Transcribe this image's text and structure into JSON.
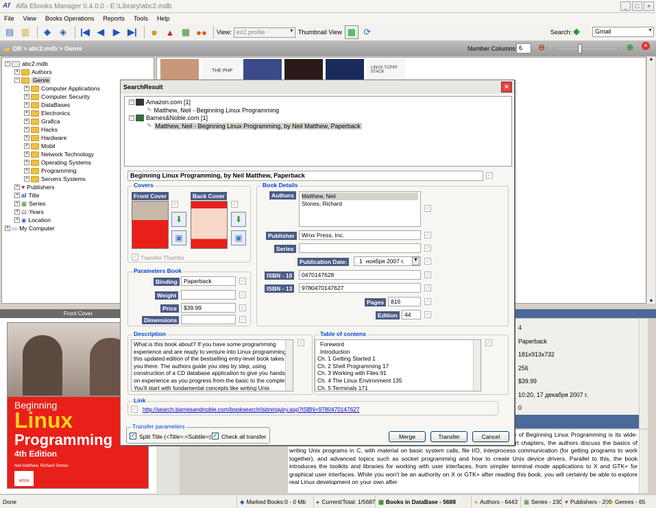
{
  "window": {
    "title": "Alfa Ebooks Manager 0.4.0.0 - E:\\Library\\abc2.mdb"
  },
  "menu": [
    "File",
    "View",
    "Books Operations",
    "Reports",
    "Tools",
    "Help"
  ],
  "toolbar": {
    "view_label": "View:",
    "view_value": "ex2.profile",
    "thumbnail_view": "Thumbnail View",
    "search_label": "Search:",
    "search_value": "Gmail"
  },
  "breadcrumb": {
    "text": "DB > abc2.mdb > Genre",
    "number_columns_label": "Number Columns:",
    "number_columns_value": "6"
  },
  "tree": {
    "root": "abc2.mdb",
    "authors": "Authors",
    "genre": "Genre",
    "genres": [
      "Computer Applications",
      "Computer Security",
      "DataBases",
      "Electronics",
      "Grafica",
      "Hacks",
      "Hardware",
      "Mobil",
      "Network Technology",
      "Operating Systems",
      "Programming",
      "Servers Systems"
    ],
    "others": [
      "Publishers",
      "Title",
      "Series",
      "Years",
      "Location"
    ],
    "my_computer": "My Computer"
  },
  "front_cover_header": "Front Cover",
  "cover_art": {
    "title_line1": "Beginning",
    "title_line2": "Linux",
    "title_line3": "Programming",
    "edition": "4th Edition",
    "authors": "Neil Matthew, Richard Stones",
    "publisher_logo": "wrox"
  },
  "thumbstrip_text": [
    "THE PHP",
    "LINUX TCP/IP STACK"
  ],
  "right_values": [
    "4",
    "Paperback",
    "181x913x732",
    "256",
    "$39.99",
    "10:20, 17 декабря 2007 г.",
    "0"
  ],
  "description_text": "Linux Programming delivers an excellent ... tial tools and APIs. The standout feature of Beginning Linux Programming is its wide-ranging coverage of important topics in basic Unix programming. In a series of short chapters, the authors discuss the basics of writing Unix programs in C, with material on basic system calls, file I/O, interprocess communication (for getting programs to work together), and advanced topics such as socket programming and how to create Unix device drivers. Parallel to this, the book introduces the toolkits and libraries for working with user interfaces, from simpler terminal mode applications to X and GTK+ for graphical user interfaces. While you won't be an authority on X or GTK+ after reading this book, you will certainly be able to explore real Linux development on your own after",
  "dialog": {
    "title": "SearchResult",
    "results": [
      {
        "source": "Amazon.com [1]",
        "item": "Matthew, Neil - Beginning Linux Programming"
      },
      {
        "source": "Barnes&Noble.com [1]",
        "item": "Matthew, Neil - Beginning Linux Programming, by Neil Matthew, Paperback"
      }
    ],
    "book_title": "Beginning Linux Programming, by Neil Matthew, Paperback",
    "covers_group": "Covers",
    "front_cover": "Front Cover",
    "back_cover": "Back Cover",
    "transfer_thumbs": "Transfer Thumbs",
    "book_details_group": "Book Details",
    "authors_label": "Authors",
    "authors": [
      "Matthew, Neil",
      "Stones, Richard"
    ],
    "publisher_label": "Publisher",
    "publisher": "Wrox Press, Inc.",
    "series_label": "Series",
    "series": "",
    "pubdate_label": "Publication Date:",
    "pubdate_day": "1",
    "pubdate_rest": "ноября   2007 г.",
    "isbn10_label": "ISBN - 10",
    "isbn10": "0470147628",
    "isbn13_label": "ISBN - 13",
    "isbn13": "9780470147627",
    "pages_label": "Pages",
    "pages": "816",
    "edition_label": "Edition",
    "edition": "44",
    "params_group": "Parameters Book",
    "binding_label": "Binding",
    "binding": "Paperback",
    "weight_label": "Weight",
    "weight": "",
    "price_label": "Price",
    "price": "$39.99",
    "dimensions_label": "Dimensions",
    "dimensions": "",
    "description_group": "Description",
    "description": "What is this book about? If you have some programming experience and are ready to venture into Linux programming, this updated edition of the bestselling entry-level book takes you there. The authors guide you step by step, using construction of a CD database application to give you hands-on experience as you progress from the basic to the complex. You'll start with fundamental concepts like writing Unix",
    "toc_group": "Table of contens",
    "toc": [
      "Foreword",
      "Introduction",
      "Ch. 1  Getting Started  1",
      "Ch. 2  Shell Programming  17",
      "Ch. 3  Working with Files  91",
      "Ch. 4  The Linux Environment  135",
      "Ch. 5  Terminals  171"
    ],
    "link_group": "Link",
    "link": "http://search.barnesandnoble.com/booksearch/isbninquiry.asp?ISBN=9780470147627",
    "transfer_group": "Transfer parameters",
    "split_title": "Split Title (<Title>:<Subtile>)",
    "check_all": "Check all transfer",
    "merge": "Merge",
    "transfer": "Transfer",
    "cancel": "Cancel"
  },
  "status": {
    "done": "Done",
    "marked": "Marked Books:0 - 0 Mb",
    "current": "Current/Total: 1/5687",
    "books_in_db": "Books in DataBase - 5688",
    "authors": "Authors - 6443",
    "series": "Series - 230",
    "publishers": "Publishers - 205",
    "genres": "Genres - 65"
  },
  "colors": {
    "label_bg": "#4a5a86",
    "group_title": "#0046d5",
    "breadcrumb": "#a8a8a8"
  }
}
